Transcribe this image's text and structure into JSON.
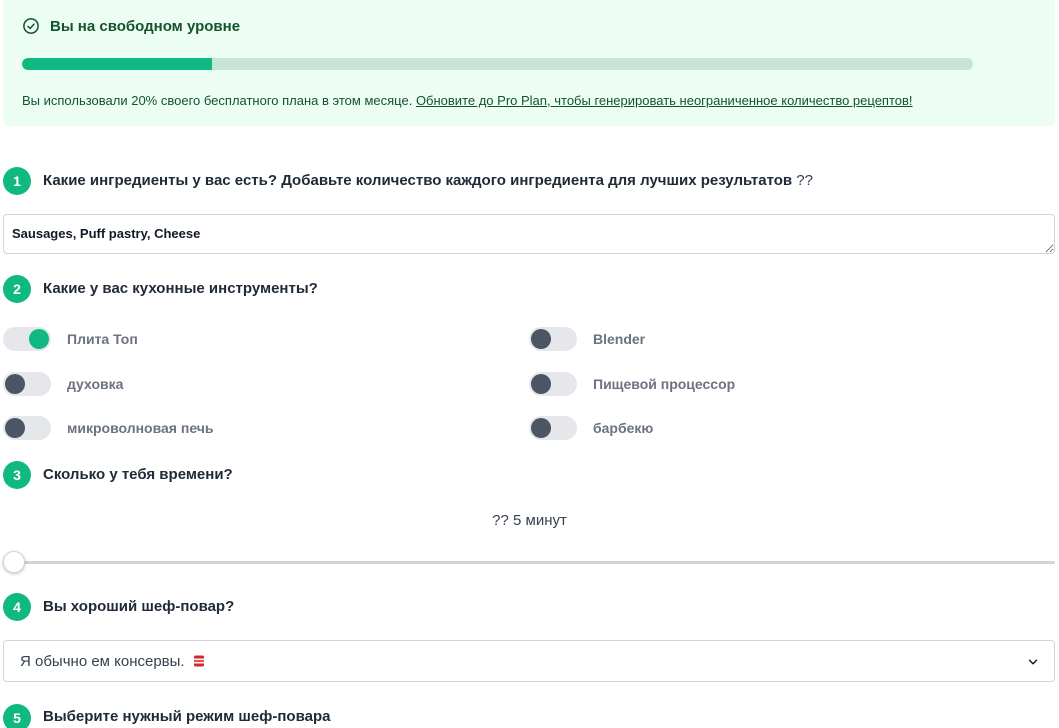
{
  "banner": {
    "title": "Вы на свободном уровне",
    "progress_percent": 20,
    "text": "Вы использовали 20% своего бесплатного плана в этом месяце. ",
    "link": "Обновите до Pro Plan, чтобы генерировать неограниченное количество рецептов!",
    "icon": "check-circle-icon"
  },
  "steps": [
    {
      "number": "1",
      "question": "Какие ингредиенты у вас есть? Добавьте количество каждого ингредиента для лучших результатов",
      "hint": " ??"
    },
    {
      "number": "2",
      "question": "Какие у вас кухонные инструменты?"
    },
    {
      "number": "3",
      "question": "Сколько у тебя времени?"
    },
    {
      "number": "4",
      "question": "Вы хороший шеф-повар?"
    },
    {
      "number": "5",
      "question": "Выберите нужный режим шеф-повара"
    }
  ],
  "ingredients_value": "Sausages, Puff pastry, Cheese",
  "tools": [
    {
      "label": "Плита Топ",
      "on": true
    },
    {
      "label": "Blender",
      "on": false
    },
    {
      "label": "духовка",
      "on": false
    },
    {
      "label": "Пищевой процессор",
      "on": false
    },
    {
      "label": "микроволновая печь",
      "on": false
    },
    {
      "label": "барбекю",
      "on": false
    }
  ],
  "time": {
    "display": "??  5 минут",
    "slider_fraction": 0
  },
  "skill_select": {
    "value": "Я обычно ем консервы.",
    "icon": "tin-can-icon"
  },
  "colors": {
    "accent": "#10b981",
    "banner_bg": "#ecfdf3",
    "knob_off": "#4b5563"
  }
}
